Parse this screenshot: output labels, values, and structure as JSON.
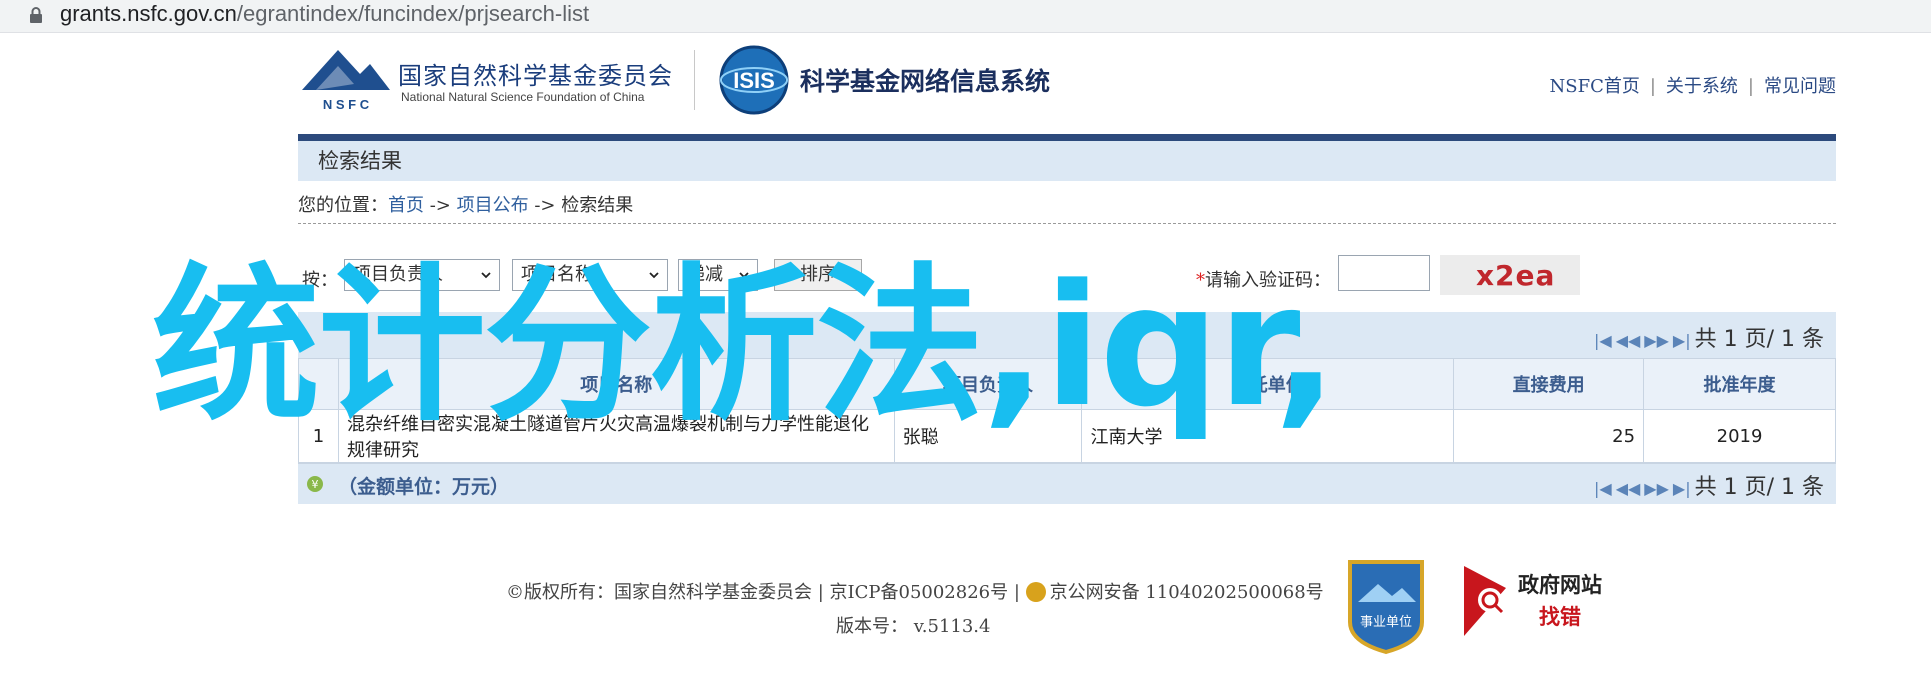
{
  "browser": {
    "url_host": "grants.nsfc.gov.cn",
    "url_path": "/egrantindex/funcindex/prjsearch-list"
  },
  "header": {
    "nsfc_name_cn": "国家自然科学基金委员会",
    "nsfc_name_en": "National Natural Science Foundation of China",
    "nsfc_abbr": "N S F C",
    "isis_abbr": "ISIS",
    "system_title": "科学基金网络信息系统",
    "nav": [
      "NSFC首页",
      "关于系统",
      "常见问题"
    ]
  },
  "panel_title": "检索结果",
  "breadcrumb": {
    "prefix": "您的位置：",
    "items": [
      "首页",
      "项目公布",
      "检索结果"
    ],
    "sep": " -> "
  },
  "search": {
    "label": "按：",
    "field1": "项目负责人",
    "field2": "项目名称",
    "order": "递减",
    "sort_button": "排序",
    "captcha_required": "*",
    "captcha_label": "请输入验证码：",
    "captcha_text": "x2ea"
  },
  "pager": {
    "text": "共 1 页/ 1 条"
  },
  "table": {
    "headers": [
      "",
      "项目名称",
      "项目负责人",
      "依托单位",
      "直接费用",
      "批准年度"
    ],
    "rows": [
      {
        "idx": "1",
        "name": "混杂纤维自密实混凝土隧道管片火灾高温爆裂机制与力学性能退化规律研究",
        "leader": "张聪",
        "institution": "江南大学",
        "fee": "25",
        "year": "2019"
      }
    ]
  },
  "unit_note": "（金额单位：万元）",
  "footer": {
    "copyright": "©版权所有：国家自然科学基金委员会 | 京ICP备05002826号 | ",
    "police": "京公网安备 11040202500068号",
    "version_label": "版本号：",
    "version": "v.5113.4",
    "badge1": "事业单位",
    "badge2_line1": "政府网站",
    "badge2_line2": "找错"
  },
  "overlay_text": "统计分析法,iqr,",
  "colors": {
    "overlay": "#18bef0",
    "nav_bar": "#2c4a7c",
    "panel": "#dce8f4",
    "link": "#2f5f9e"
  }
}
